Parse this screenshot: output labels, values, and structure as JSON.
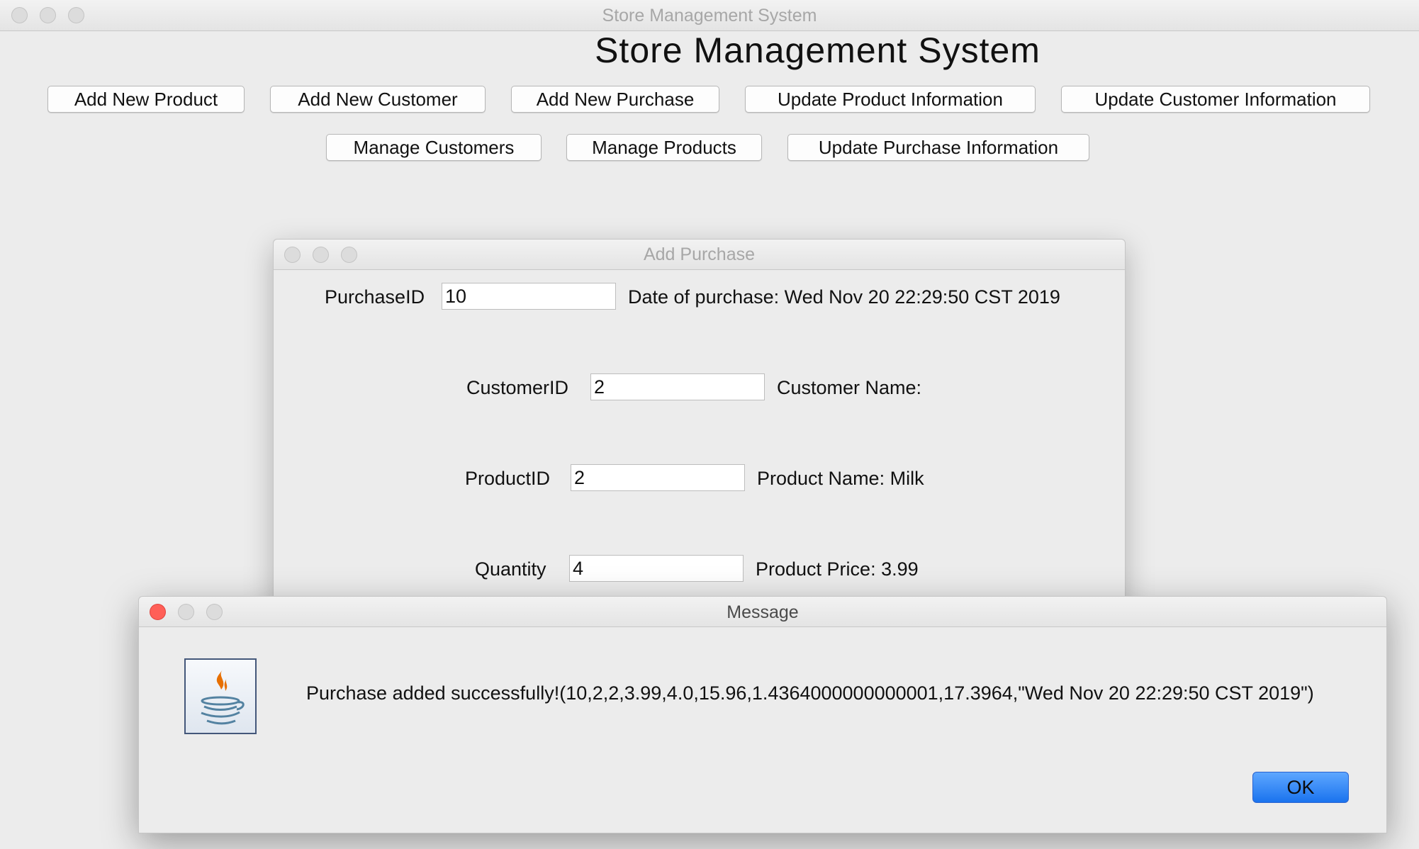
{
  "main_window": {
    "title": "Store Management System",
    "heading": "Store Management System",
    "buttons_row1": [
      "Add New Product",
      "Add New Customer",
      "Add New Purchase",
      "Update Product Information",
      "Update Customer Information"
    ],
    "buttons_row2": [
      "Manage Customers",
      "Manage Products",
      "Update Purchase Information"
    ]
  },
  "add_purchase": {
    "title": "Add Purchase",
    "purchase_id_label": "PurchaseID",
    "purchase_id_value": "10",
    "date_label": "Date of purchase: Wed Nov 20 22:29:50 CST 2019",
    "customer_id_label": "CustomerID",
    "customer_id_value": "2",
    "customer_name_label": "Customer Name:",
    "product_id_label": "ProductID",
    "product_id_value": "2",
    "product_name_label": "Product Name: Milk",
    "quantity_label": "Quantity",
    "quantity_value": "4",
    "product_price_label": "Product Price: 3.99"
  },
  "message_dialog": {
    "title": "Message",
    "text": "Purchase added successfully!(10,2,2,3.99,4.0,15.96,1.4364000000000001,17.3964,\"Wed Nov 20 22:29:50 CST 2019\")",
    "ok_label": "OK",
    "icon": "java-icon"
  },
  "colors": {
    "window_bg": "#ececec",
    "ok_button": "#1a73ee",
    "close_red": "#ff5f57"
  }
}
